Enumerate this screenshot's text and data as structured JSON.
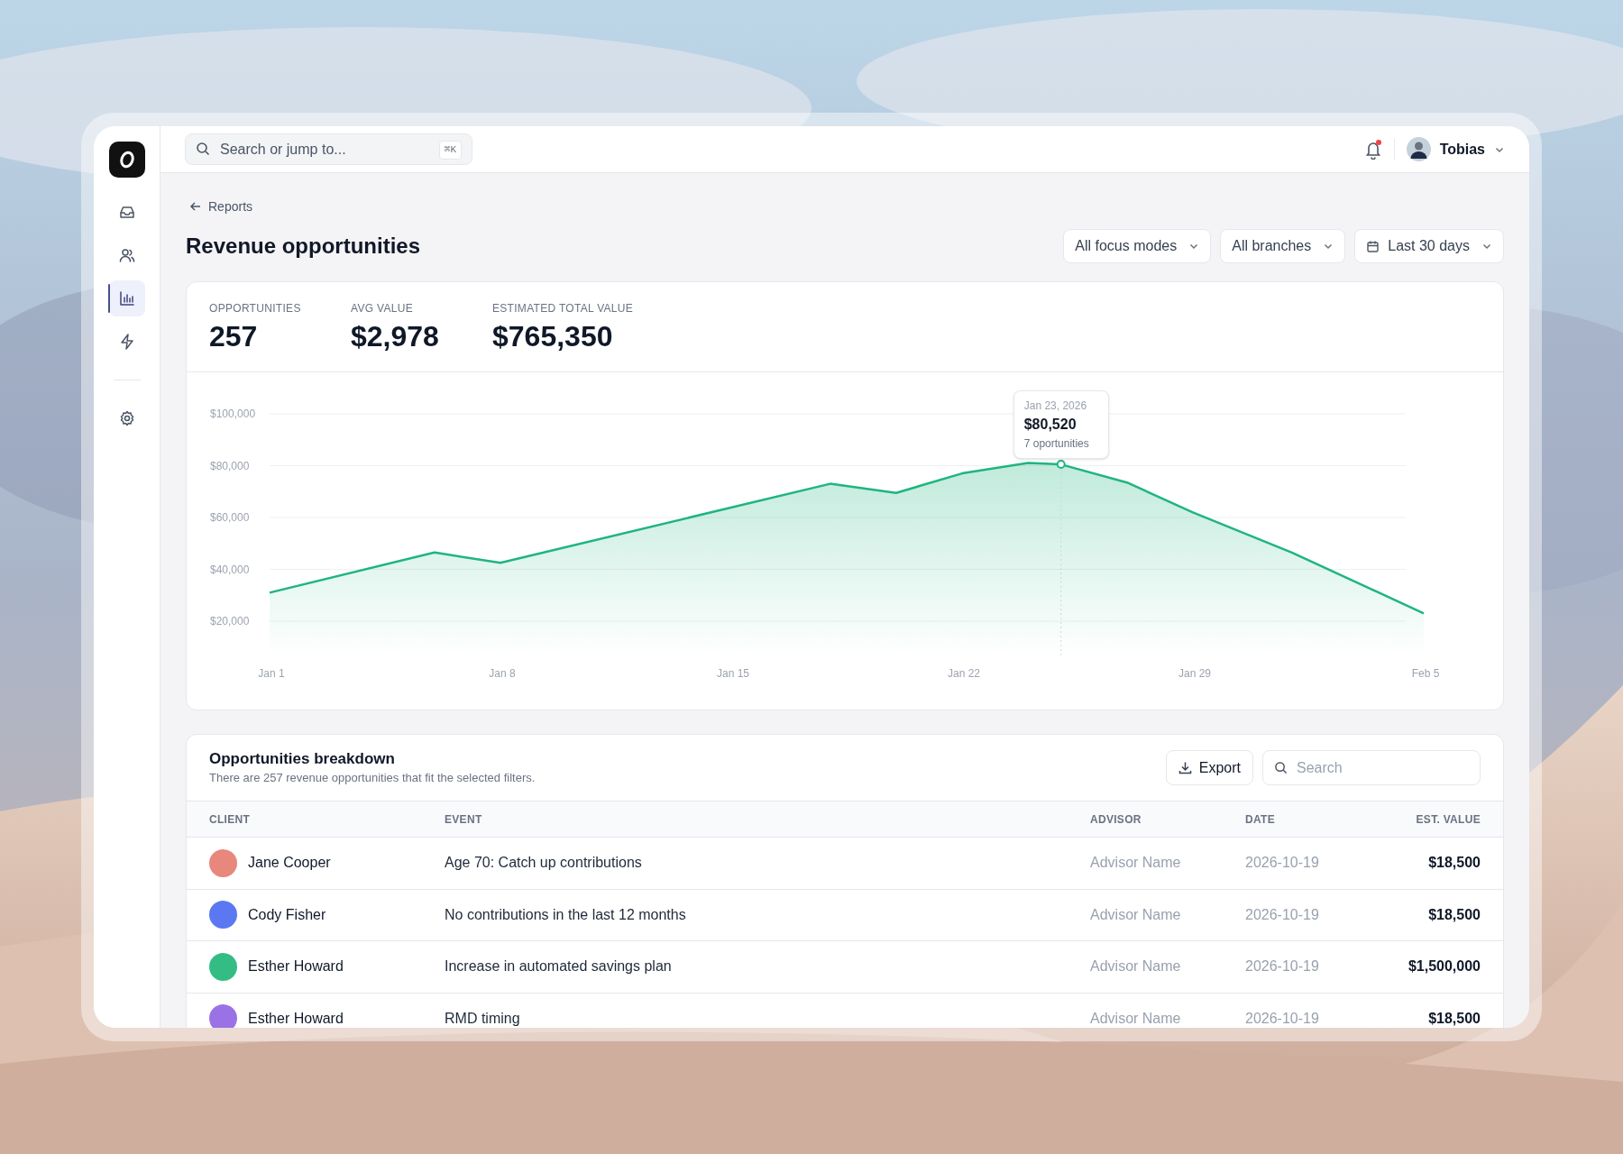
{
  "sidebar": {
    "items": [
      {
        "selected": false
      },
      {
        "selected": false
      },
      {
        "selected": true
      },
      {
        "selected": false
      },
      {
        "selected": false
      }
    ]
  },
  "topbar": {
    "search": {
      "placeholder": "Search or jump to...",
      "shortcut": "⌘K"
    },
    "notifications": {
      "unread": true
    },
    "user": {
      "name": "Tobias"
    }
  },
  "breadcrumb": "Reports",
  "title": "Revenue opportunities",
  "filters": [
    {
      "label": "All focus modes",
      "kind": "select"
    },
    {
      "label": "All branches",
      "kind": "select"
    },
    {
      "label": "Last 30 days",
      "kind": "date"
    }
  ],
  "stats": [
    {
      "label": "OPPORTUNITIES",
      "value": "257"
    },
    {
      "label": "AVG VALUE",
      "value": "$2,978"
    },
    {
      "label": "ESTIMATED TOTAL VALUE",
      "value": "$765,350"
    }
  ],
  "chart": {
    "tooltip": {
      "date": "Jan 23, 2026",
      "value": "$80,520",
      "count": "7 oportunities"
    },
    "chart_data": {
      "type": "area",
      "categories": [
        "Jan 1",
        null,
        null,
        null,
        null,
        null,
        null,
        "Jan 8",
        null,
        null,
        null,
        null,
        null,
        null,
        "Jan 15",
        null,
        null,
        null,
        null,
        null,
        null,
        "Jan 22",
        null,
        null,
        null,
        null,
        null,
        null,
        "Jan 29",
        null,
        null,
        null,
        null,
        null,
        null,
        "Feb 5"
      ],
      "series": [
        {
          "color": "#1fb57f",
          "values": [
            31000,
            null,
            null,
            null,
            null,
            46500,
            null,
            42500,
            null,
            null,
            null,
            null,
            null,
            null,
            null,
            null,
            null,
            73000,
            null,
            69500,
            null,
            77000,
            null,
            81000,
            80500,
            null,
            73500,
            null,
            62000,
            null,
            null,
            46500,
            null,
            null,
            null,
            23000
          ]
        }
      ],
      "grid": true,
      "ylim": [
        20000,
        100000
      ],
      "yticks": [
        {
          "value": 20000,
          "label": "$20,000"
        },
        {
          "value": 40000,
          "label": "$40,000"
        },
        {
          "value": 60000,
          "label": "$60,000"
        },
        {
          "value": 80000,
          "label": "$80,000"
        },
        {
          "value": 100000,
          "label": "$100,000"
        }
      ]
    }
  },
  "breakdown": {
    "title": "Opportunities breakdown",
    "subtitle": "There are 257 revenue opportunities that fit the selected filters.",
    "export": "Export",
    "search_placeholder": "Search",
    "columns": [
      "CLIENT",
      "EVENT",
      "ADVISOR",
      "DATE",
      "EST. VALUE"
    ],
    "rows": [
      {
        "client": "Jane Cooper",
        "color": "#e8877c",
        "event": "Age 70: Catch up contributions",
        "advisor": "Advisor Name",
        "date": "2026-10-19",
        "value": "$18,500"
      },
      {
        "client": "Cody Fisher",
        "color": "#5b78f2",
        "event": "No contributions in the last 12 months",
        "advisor": "Advisor Name",
        "date": "2026-10-19",
        "value": "$18,500"
      },
      {
        "client": "Esther Howard",
        "color": "#33bd85",
        "event": "Increase in automated savings plan",
        "advisor": "Advisor Name",
        "date": "2026-10-19",
        "value": "$1,500,000"
      },
      {
        "client": "Esther Howard",
        "color": "#9b72e6",
        "event": "RMD timing",
        "advisor": "Advisor Name",
        "date": "2026-10-19",
        "value": "$18,500"
      }
    ]
  }
}
